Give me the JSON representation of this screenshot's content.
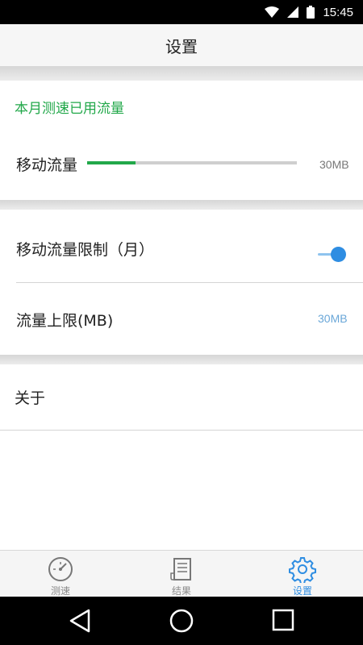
{
  "status_bar": {
    "time": "15:45",
    "icons": [
      "wifi-icon",
      "signal-icon",
      "battery-icon"
    ]
  },
  "header": {
    "title": "设置"
  },
  "usage": {
    "title": "本月测速已用流量",
    "mobile_label": "移动流量",
    "used_fraction": 0.23,
    "value": "30MB"
  },
  "limit": {
    "toggle_label": "移动流量限制（月）",
    "toggle_on": true,
    "limit_label": "流量上限(MB)",
    "limit_value": "30MB"
  },
  "about": {
    "label": "关于"
  },
  "bottom_nav": {
    "items": [
      {
        "label": "测速",
        "icon": "speedometer-icon"
      },
      {
        "label": "结果",
        "icon": "document-list-icon"
      },
      {
        "label": "设置",
        "icon": "gear-icon",
        "active": true
      }
    ]
  },
  "system_nav": {
    "icons": [
      "back-icon",
      "home-icon",
      "recents-icon"
    ]
  },
  "colors": {
    "accent_green": "#22a84a",
    "accent_blue": "#2e8de2",
    "limit_value_color": "#6aa7d8",
    "value_gray": "#777777"
  }
}
